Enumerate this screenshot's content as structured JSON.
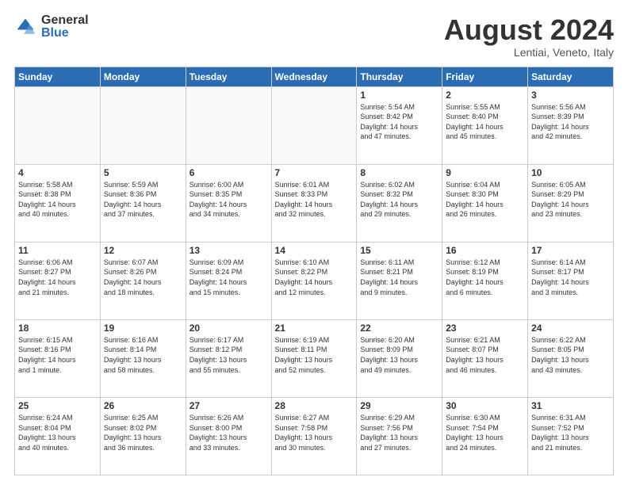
{
  "logo": {
    "general": "General",
    "blue": "Blue"
  },
  "header": {
    "month": "August 2024",
    "location": "Lentiai, Veneto, Italy"
  },
  "weekdays": [
    "Sunday",
    "Monday",
    "Tuesday",
    "Wednesday",
    "Thursday",
    "Friday",
    "Saturday"
  ],
  "weeks": [
    [
      {
        "day": "",
        "info": ""
      },
      {
        "day": "",
        "info": ""
      },
      {
        "day": "",
        "info": ""
      },
      {
        "day": "",
        "info": ""
      },
      {
        "day": "1",
        "info": "Sunrise: 5:54 AM\nSunset: 8:42 PM\nDaylight: 14 hours\nand 47 minutes."
      },
      {
        "day": "2",
        "info": "Sunrise: 5:55 AM\nSunset: 8:40 PM\nDaylight: 14 hours\nand 45 minutes."
      },
      {
        "day": "3",
        "info": "Sunrise: 5:56 AM\nSunset: 8:39 PM\nDaylight: 14 hours\nand 42 minutes."
      }
    ],
    [
      {
        "day": "4",
        "info": "Sunrise: 5:58 AM\nSunset: 8:38 PM\nDaylight: 14 hours\nand 40 minutes."
      },
      {
        "day": "5",
        "info": "Sunrise: 5:59 AM\nSunset: 8:36 PM\nDaylight: 14 hours\nand 37 minutes."
      },
      {
        "day": "6",
        "info": "Sunrise: 6:00 AM\nSunset: 8:35 PM\nDaylight: 14 hours\nand 34 minutes."
      },
      {
        "day": "7",
        "info": "Sunrise: 6:01 AM\nSunset: 8:33 PM\nDaylight: 14 hours\nand 32 minutes."
      },
      {
        "day": "8",
        "info": "Sunrise: 6:02 AM\nSunset: 8:32 PM\nDaylight: 14 hours\nand 29 minutes."
      },
      {
        "day": "9",
        "info": "Sunrise: 6:04 AM\nSunset: 8:30 PM\nDaylight: 14 hours\nand 26 minutes."
      },
      {
        "day": "10",
        "info": "Sunrise: 6:05 AM\nSunset: 8:29 PM\nDaylight: 14 hours\nand 23 minutes."
      }
    ],
    [
      {
        "day": "11",
        "info": "Sunrise: 6:06 AM\nSunset: 8:27 PM\nDaylight: 14 hours\nand 21 minutes."
      },
      {
        "day": "12",
        "info": "Sunrise: 6:07 AM\nSunset: 8:26 PM\nDaylight: 14 hours\nand 18 minutes."
      },
      {
        "day": "13",
        "info": "Sunrise: 6:09 AM\nSunset: 8:24 PM\nDaylight: 14 hours\nand 15 minutes."
      },
      {
        "day": "14",
        "info": "Sunrise: 6:10 AM\nSunset: 8:22 PM\nDaylight: 14 hours\nand 12 minutes."
      },
      {
        "day": "15",
        "info": "Sunrise: 6:11 AM\nSunset: 8:21 PM\nDaylight: 14 hours\nand 9 minutes."
      },
      {
        "day": "16",
        "info": "Sunrise: 6:12 AM\nSunset: 8:19 PM\nDaylight: 14 hours\nand 6 minutes."
      },
      {
        "day": "17",
        "info": "Sunrise: 6:14 AM\nSunset: 8:17 PM\nDaylight: 14 hours\nand 3 minutes."
      }
    ],
    [
      {
        "day": "18",
        "info": "Sunrise: 6:15 AM\nSunset: 8:16 PM\nDaylight: 14 hours\nand 1 minute."
      },
      {
        "day": "19",
        "info": "Sunrise: 6:16 AM\nSunset: 8:14 PM\nDaylight: 13 hours\nand 58 minutes."
      },
      {
        "day": "20",
        "info": "Sunrise: 6:17 AM\nSunset: 8:12 PM\nDaylight: 13 hours\nand 55 minutes."
      },
      {
        "day": "21",
        "info": "Sunrise: 6:19 AM\nSunset: 8:11 PM\nDaylight: 13 hours\nand 52 minutes."
      },
      {
        "day": "22",
        "info": "Sunrise: 6:20 AM\nSunset: 8:09 PM\nDaylight: 13 hours\nand 49 minutes."
      },
      {
        "day": "23",
        "info": "Sunrise: 6:21 AM\nSunset: 8:07 PM\nDaylight: 13 hours\nand 46 minutes."
      },
      {
        "day": "24",
        "info": "Sunrise: 6:22 AM\nSunset: 8:05 PM\nDaylight: 13 hours\nand 43 minutes."
      }
    ],
    [
      {
        "day": "25",
        "info": "Sunrise: 6:24 AM\nSunset: 8:04 PM\nDaylight: 13 hours\nand 40 minutes."
      },
      {
        "day": "26",
        "info": "Sunrise: 6:25 AM\nSunset: 8:02 PM\nDaylight: 13 hours\nand 36 minutes."
      },
      {
        "day": "27",
        "info": "Sunrise: 6:26 AM\nSunset: 8:00 PM\nDaylight: 13 hours\nand 33 minutes."
      },
      {
        "day": "28",
        "info": "Sunrise: 6:27 AM\nSunset: 7:58 PM\nDaylight: 13 hours\nand 30 minutes."
      },
      {
        "day": "29",
        "info": "Sunrise: 6:29 AM\nSunset: 7:56 PM\nDaylight: 13 hours\nand 27 minutes."
      },
      {
        "day": "30",
        "info": "Sunrise: 6:30 AM\nSunset: 7:54 PM\nDaylight: 13 hours\nand 24 minutes."
      },
      {
        "day": "31",
        "info": "Sunrise: 6:31 AM\nSunset: 7:52 PM\nDaylight: 13 hours\nand 21 minutes."
      }
    ]
  ]
}
